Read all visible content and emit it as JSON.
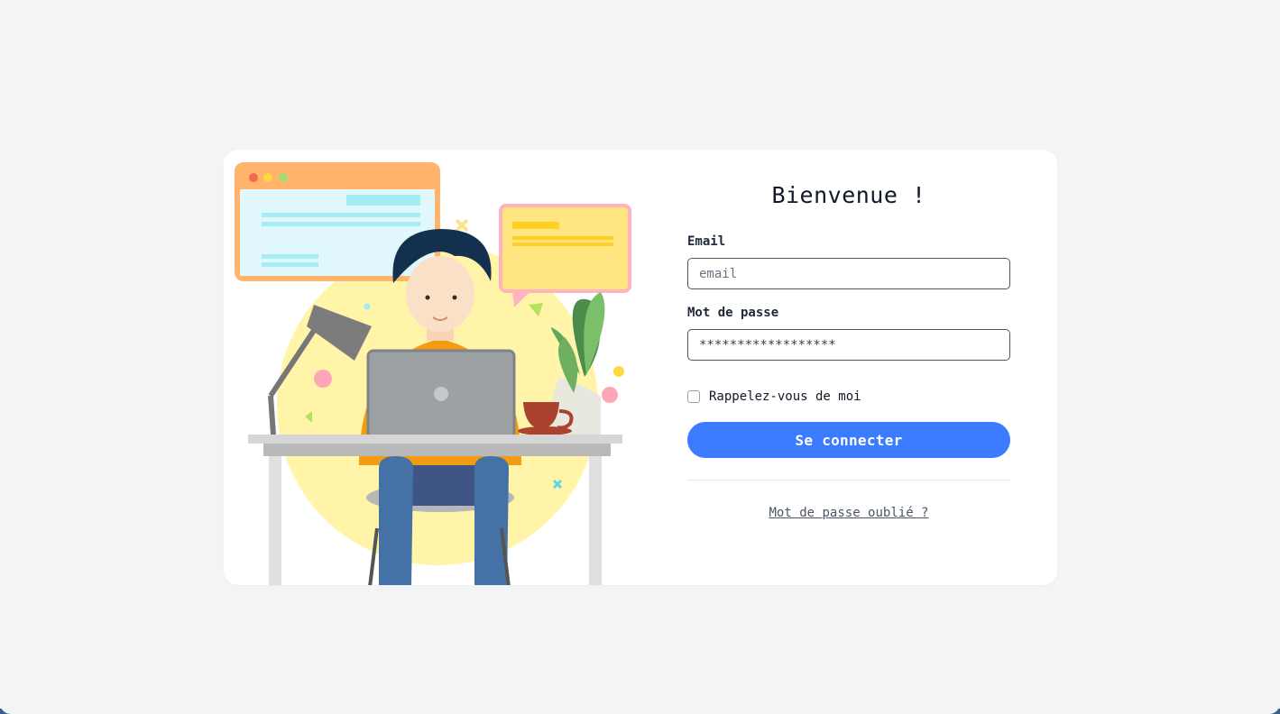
{
  "login": {
    "title": "Bienvenue !",
    "email_label": "Email",
    "email_placeholder": "email",
    "password_label": "Mot de passe",
    "password_value": "******************",
    "remember_label": "Rappelez-vous de moi",
    "remember_checked": false,
    "submit_label": "Se connecter",
    "forgot_label": "Mot de passe oublié ?"
  },
  "illustration": {
    "subject": "person-working-on-laptop",
    "colors": {
      "sun": "#fff4a8",
      "browser_window": "#ffb36b",
      "chat_bubble": "#ffe680",
      "hair": "#13314f",
      "laptop": "#9ea1a3",
      "jeans": "#4472a6",
      "shirt": "#f39c12"
    }
  },
  "theme": {
    "accent": "#3b7bff",
    "background": "#f3f4f6",
    "card": "#ffffff"
  }
}
